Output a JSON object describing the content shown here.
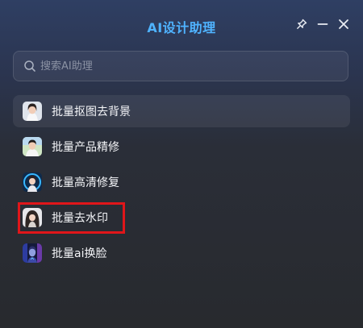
{
  "window": {
    "title": "AI设计助理",
    "accent": "#4fb3ff",
    "controls": {
      "pin": "pin-icon",
      "minimize": "minimize-icon",
      "close": "close-icon"
    }
  },
  "search": {
    "icon": "search-icon",
    "placeholder": "搜索AI助理",
    "value": ""
  },
  "items": [
    {
      "label": "批量抠图去背景",
      "avatar": "avatar-woman-white-shirt",
      "active": true
    },
    {
      "label": "批量产品精修",
      "avatar": "avatar-man-green-background",
      "active": false
    },
    {
      "label": "批量高清修复",
      "avatar": "avatar-woman-blue-glow",
      "active": false
    },
    {
      "label": "批量去水印",
      "avatar": "avatar-woman-long-hair",
      "active": false,
      "highlighted": true
    },
    {
      "label": "批量ai换脸",
      "avatar": "avatar-cyber-face",
      "active": false
    }
  ],
  "highlight_color": "#e0161a"
}
